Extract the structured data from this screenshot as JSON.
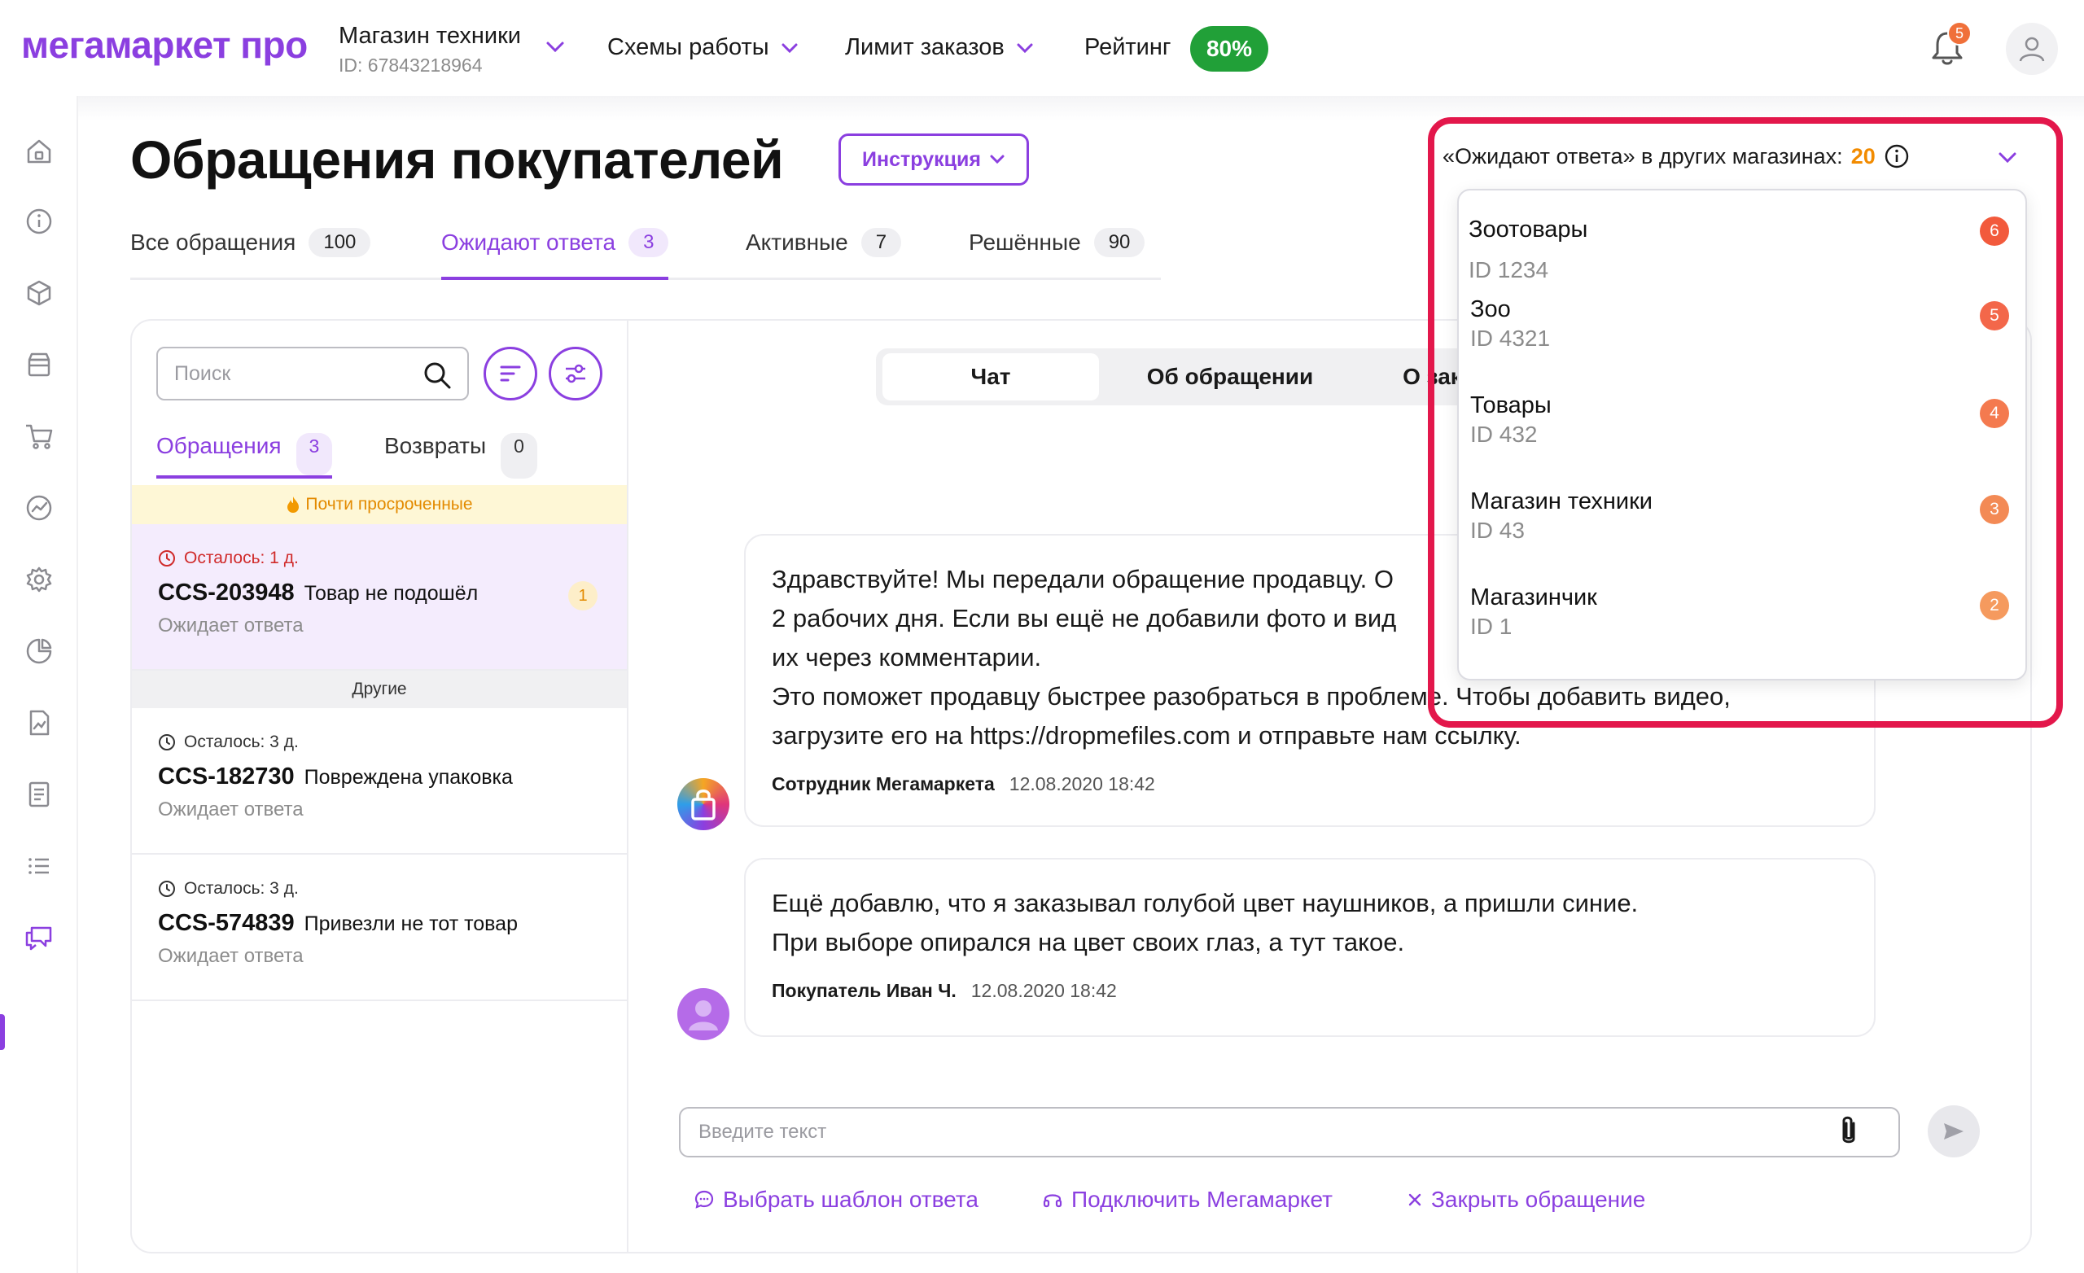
{
  "header": {
    "logo": "мегамаркет про",
    "store_name": "Магазин техники",
    "store_id": "ID: 67843218964",
    "nav": [
      "Схемы работы",
      "Лимит заказов"
    ],
    "rating_label": "Рейтинг",
    "rating_value": "80%",
    "notifications_count": "5"
  },
  "sidebar": {
    "icons": [
      "home-icon",
      "info-icon",
      "box-icon",
      "store-icon",
      "cart-icon",
      "analytics-icon",
      "settings-icon",
      "pie-chart-icon",
      "report-icon",
      "document-icon",
      "list-icon",
      "chat-icon"
    ],
    "active": "chat-icon"
  },
  "page": {
    "title": "Обращения покупателей",
    "instruction_label": "Инструкция"
  },
  "tabs": [
    {
      "label": "Все обращения",
      "count": "100"
    },
    {
      "label": "Ожидают ответа",
      "count": "3",
      "active": true
    },
    {
      "label": "Активные",
      "count": "7"
    },
    {
      "label": "Решённые",
      "count": "90"
    }
  ],
  "list": {
    "search_placeholder": "Поиск",
    "subtabs": [
      {
        "label": "Обращения",
        "count": "3",
        "active": true
      },
      {
        "label": "Возвраты",
        "count": "0"
      }
    ],
    "group_warning": "Почти просроченные",
    "group_other": "Другие",
    "tickets": [
      {
        "left": "Осталось: 1 д.",
        "code": "CCS-203948",
        "subject": "Товар не подошёл",
        "status": "Ожидает ответа",
        "unread": "1"
      },
      {
        "left": "Осталось: 3 д.",
        "code": "CCS-182730",
        "subject": "Повреждена упаковка",
        "status": "Ожидает ответа"
      },
      {
        "left": "Осталось: 3 д.",
        "code": "CCS-574839",
        "subject": "Привезли не тот товар",
        "status": "Ожидает ответа"
      }
    ]
  },
  "chat": {
    "segments": [
      "Чат",
      "Об обращении",
      "О заказе"
    ],
    "messages": [
      {
        "text": "Здравствуйте! Мы передали обращение продавцу. О\n2 рабочих дня. Если вы ещё не добавили фото и вид\nих через комментарии.\nЭто поможет продавцу быстрее разобраться в проблеме. Чтобы добавить видео,\nзагрузите его на https://dropmefiles.com и отправьте нам ссылку.",
        "author": "Сотрудник Мегамаркета",
        "date": "12.08.2020 18:42"
      },
      {
        "text": "Ещё добавлю, что я заказывал голубой цвет наушников, а пришли синие.\nПри выборе опирался на цвет своих глаз, а тут такое.",
        "author": "Покупатель Иван Ч.",
        "date": "12.08.2020 18:42"
      }
    ],
    "input_placeholder": "Введите текст",
    "actions": [
      "Выбрать шаблон ответа",
      "Подключить Мегамаркет",
      "Закрыть обращение"
    ]
  },
  "other_stores": {
    "label": "«Ожидают ответа» в других магазинах:",
    "count": "20",
    "stores": [
      {
        "name": "Зоотовары",
        "id": "ID 1234",
        "count": "6",
        "color": "#f25a3c"
      },
      {
        "name": "Зоо",
        "id": "ID 4321",
        "count": "5",
        "color": "#f3674a"
      },
      {
        "name": "Товары",
        "id": "ID 432",
        "count": "4",
        "color": "#f47a4f"
      },
      {
        "name": "Магазин техники",
        "id": "ID 43",
        "count": "3",
        "color": "#f38a55"
      },
      {
        "name": "Магазинчик",
        "id": "ID 1",
        "count": "2",
        "color": "#f59a5e"
      }
    ]
  },
  "colors": {
    "accent": "#8b3fe0",
    "rating": "#21a038",
    "highlight": "#e3174b"
  }
}
